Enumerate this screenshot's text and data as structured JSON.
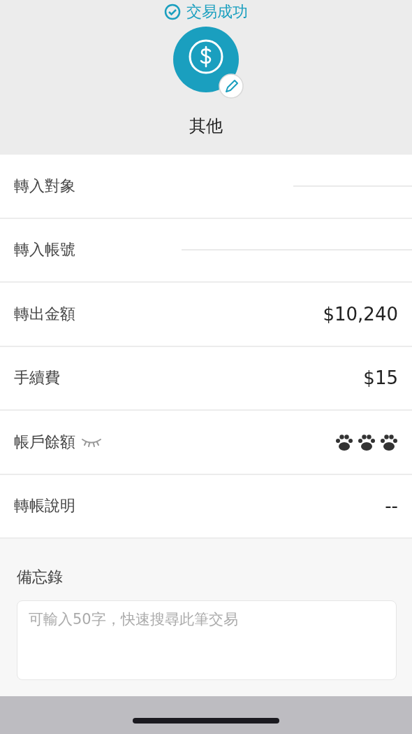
{
  "header": {
    "title": "交易成功",
    "category": "其他"
  },
  "rows": [
    {
      "label": "轉入對象",
      "kind": "masked"
    },
    {
      "label": "轉入帳號",
      "kind": "masked"
    },
    {
      "label": "轉出金額",
      "kind": "text",
      "value": "$10,240"
    },
    {
      "label": "手續費",
      "kind": "text",
      "value": "$15"
    },
    {
      "label": "帳戶餘額",
      "kind": "hidden",
      "masked": true
    },
    {
      "label": "轉帳說明",
      "kind": "text",
      "value": "--"
    }
  ],
  "memo": {
    "label": "備忘錄",
    "placeholder": "可輸入50字，快速搜尋此筆交易"
  }
}
